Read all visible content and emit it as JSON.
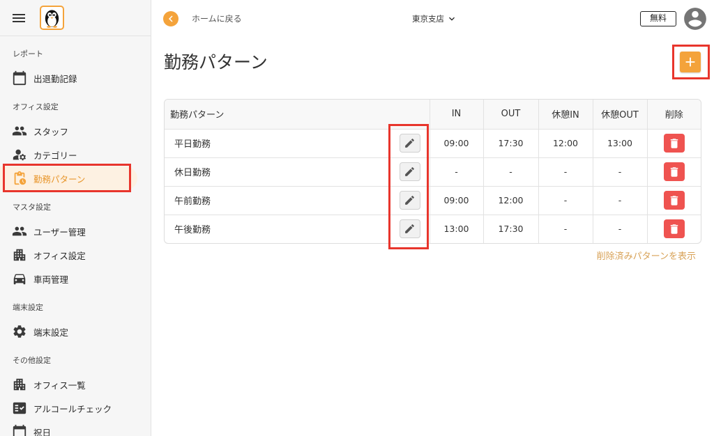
{
  "colors": {
    "accent": "#F4A33B",
    "accent_text": "#E8962C",
    "accent_soft": "#FDF1E2",
    "link": "#D8A257",
    "danger": "#EF5350",
    "annotation": "#E8352C",
    "sidebar_bg": "#F6F6F6"
  },
  "sidebar": {
    "menu_icon": "hamburger-menu-icon",
    "logo_icon": "penguin-logo-icon",
    "sections": [
      {
        "title": "レポート",
        "items": [
          {
            "label": "出退勤記録",
            "icon": "calendar-icon"
          }
        ]
      },
      {
        "title": "オフィス設定",
        "items": [
          {
            "label": "スタッフ",
            "icon": "people-icon"
          },
          {
            "label": "カテゴリー",
            "icon": "manage-accounts-icon"
          },
          {
            "label": "勤務パターン",
            "icon": "pending-actions-icon",
            "active": true
          }
        ]
      },
      {
        "title": "マスタ設定",
        "items": [
          {
            "label": "ユーザー管理",
            "icon": "people-icon"
          },
          {
            "label": "オフィス設定",
            "icon": "apartment-icon"
          },
          {
            "label": "車両管理",
            "icon": "car-icon"
          }
        ]
      },
      {
        "title": "端末設定",
        "items": [
          {
            "label": "端末設定",
            "icon": "gear-icon"
          }
        ]
      },
      {
        "title": "その他設定",
        "items": [
          {
            "label": "オフィス一覧",
            "icon": "apartment-icon"
          },
          {
            "label": "アルコールチェック",
            "icon": "fact-check-icon"
          },
          {
            "label": "祝日",
            "icon": "calendar-icon"
          }
        ]
      }
    ]
  },
  "header": {
    "back_icon": "chevron-left-icon",
    "back_label": "ホームに戻る",
    "branch": "東京支店",
    "branch_icon": "chevron-down-icon",
    "plan_badge": "無料",
    "avatar_icon": "account-circle-icon"
  },
  "main": {
    "title": "勤務パターン",
    "add_icon": "plus-icon",
    "table": {
      "columns": [
        "勤務パターン",
        "IN",
        "OUT",
        "休憩IN",
        "休憩OUT",
        "削除"
      ],
      "edit_icon": "pencil-icon",
      "delete_icon": "trash-icon",
      "rows": [
        {
          "name": "平日勤務",
          "in": "09:00",
          "out": "17:30",
          "break_in": "12:00",
          "break_out": "13:00"
        },
        {
          "name": "休日勤務",
          "in": "-",
          "out": "-",
          "break_in": "-",
          "break_out": "-"
        },
        {
          "name": "午前勤務",
          "in": "09:00",
          "out": "12:00",
          "break_in": "-",
          "break_out": "-"
        },
        {
          "name": "午後勤務",
          "in": "13:00",
          "out": "17:30",
          "break_in": "-",
          "break_out": "-"
        }
      ]
    },
    "show_deleted_link": "削除済みパターンを表示"
  }
}
